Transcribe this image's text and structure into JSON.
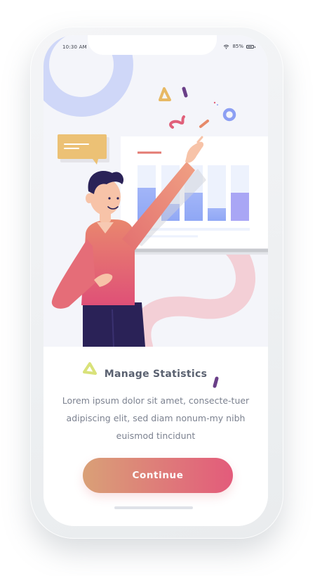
{
  "status_bar": {
    "time": "10:30 AM",
    "battery": "85%",
    "icons": [
      "wifi-icon",
      "battery-icon"
    ]
  },
  "onboarding": {
    "title": "Manage Statistics",
    "description": "Lorem ipsum dolor sit amet, consecte-tuer adipiscing elit, sed diam nonum-my nibh euismod tincidunt",
    "continue_label": "Continue"
  },
  "colors": {
    "accent_start": "#d9a077",
    "accent_end": "#e35b7b",
    "hero_background": "#f4f5fa",
    "title_text": "#5a6170",
    "body_text": "#7c8290"
  }
}
